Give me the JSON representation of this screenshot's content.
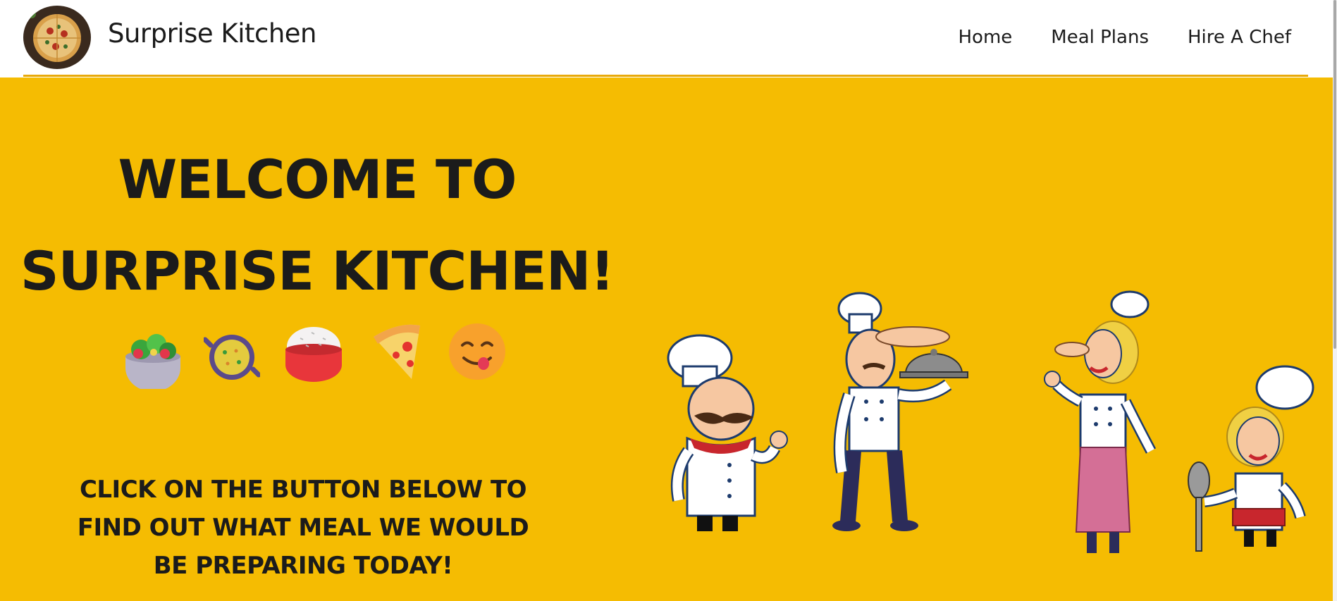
{
  "nav": {
    "brand": "Surprise Kitchen",
    "logo_icon": "pizza-logo-icon",
    "links": [
      "Home",
      "Meal Plans",
      "Hire A Chef"
    ]
  },
  "hero": {
    "headline_line1": "WELCOME TO",
    "headline_line2": "SURPRISE KITCHEN!",
    "emoji_icons": [
      "salad-icon",
      "paella-pan-icon",
      "rice-bowl-icon",
      "pizza-slice-icon",
      "yum-face-icon"
    ],
    "subtext_line1": "CLICK ON THE BUTTON BELOW TO",
    "subtext_line2": "FIND OUT WHAT MEAL WE WOULD",
    "subtext_line3": "BE PREPARING TODAY!",
    "illustration": "chefs-illustration"
  },
  "colors": {
    "hero_background": "#f5bc02",
    "nav_rule": "#e8a90a",
    "text": "#1b1b1b",
    "nav_background": "#ffffff"
  }
}
